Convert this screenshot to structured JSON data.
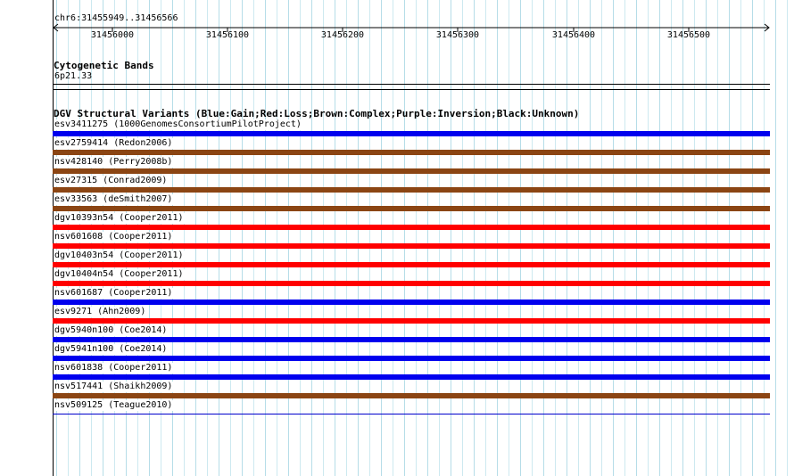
{
  "coordinate_range": "chr6:31455949..31456566",
  "ruler": {
    "ticks": [
      "31456000",
      "31456100",
      "31456200",
      "31456300",
      "31456400",
      "31456500"
    ]
  },
  "cytogenetic": {
    "title": "Cytogenetic Bands",
    "band": "6p21.33"
  },
  "dgv": {
    "title": "DGV Structural Variants (Blue:Gain;Red:Loss;Brown:Complex;Purple:Inversion;Black:Unknown)",
    "colors": {
      "gain": "#0000ee",
      "loss": "#ff0000",
      "complex": "#8b4513"
    },
    "variants": [
      {
        "label": "esv3411275 (1000GenomesConsortiumPilotProject)",
        "type": "gain"
      },
      {
        "label": "esv2759414 (Redon2006)",
        "type": "complex"
      },
      {
        "label": "nsv428140 (Perry2008b)",
        "type": "complex"
      },
      {
        "label": "esv27315 (Conrad2009)",
        "type": "complex"
      },
      {
        "label": "esv33563 (deSmith2007)",
        "type": "complex"
      },
      {
        "label": "dgv10393n54 (Cooper2011)",
        "type": "loss"
      },
      {
        "label": "nsv601608 (Cooper2011)",
        "type": "loss"
      },
      {
        "label": "dgv10403n54 (Cooper2011)",
        "type": "loss"
      },
      {
        "label": "dgv10404n54 (Cooper2011)",
        "type": "loss"
      },
      {
        "label": "nsv601687 (Cooper2011)",
        "type": "gain"
      },
      {
        "label": "esv9271 (Ahn2009)",
        "type": "loss"
      },
      {
        "label": "dgv5940n100 (Coe2014)",
        "type": "gain"
      },
      {
        "label": "dgv5941n100 (Coe2014)",
        "type": "gain"
      },
      {
        "label": "nsv601838 (Cooper2011)",
        "type": "gain"
      },
      {
        "label": "nsv517441 (Shaikh2009)",
        "type": "complex"
      },
      {
        "label": "nsv509125 (Teague2010)",
        "type": "gain"
      }
    ]
  }
}
